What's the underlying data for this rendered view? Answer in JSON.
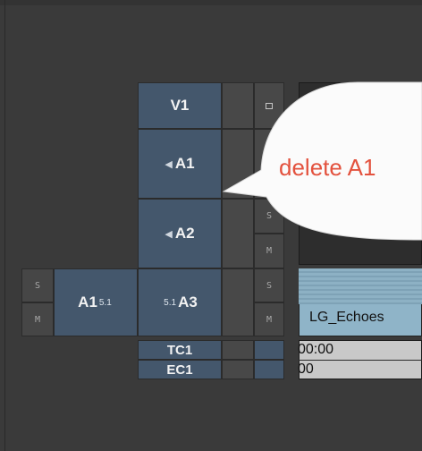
{
  "tracks": {
    "v1": "V1",
    "a1": "A1",
    "a2": "A2",
    "a3": "A3",
    "tc1": "TC1",
    "ec1": "EC1",
    "source_a1": "A1",
    "source_format": "5.1",
    "a3_format": "5.1",
    "speaker_icon": "◀",
    "solo_label": "S",
    "mute_label": "M"
  },
  "clip": {
    "name": "LG_Echoes"
  },
  "timecode": {
    "tc_row": "00:00",
    "ec_row": "00"
  },
  "callout": {
    "text": "delete A1",
    "color": "#e3523e"
  },
  "colors": {
    "track_fill": "#44576c",
    "clip_fill": "#8fb4c8",
    "background": "#3a3a3a"
  }
}
